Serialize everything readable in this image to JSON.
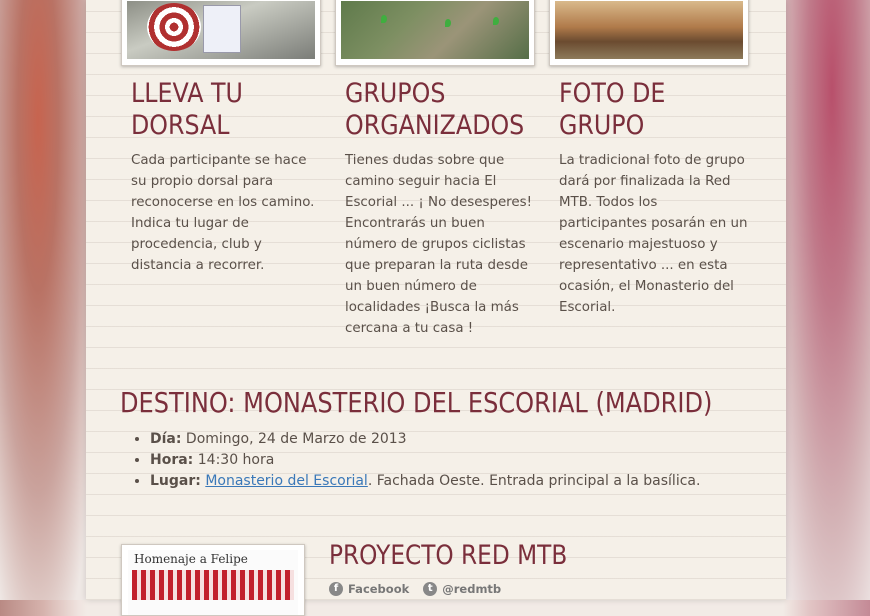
{
  "features": [
    {
      "title_line1": "LLEVA TU",
      "title_line2": "DORSAL",
      "text": "Cada participante se hace su propio dorsal para reconocerse en los camino. Indica tu lugar de procedencia, club y distancia a recorrer."
    },
    {
      "title_line1": "GRUPOS",
      "title_line2": "ORGANIZADOS",
      "text": "Tienes dudas sobre que camino seguir hacia El Escorial ... ¡ No desesperes! Encontrarás un buen número de grupos ciclistas que preparan la ruta desde un buen número de localidades ¡Busca la más cercana a tu casa !"
    },
    {
      "title_line1": "FOTO DE",
      "title_line2": "GRUPO",
      "text": "La tradicional foto de grupo dará por finalizada la Red MTB. Todos los participantes posarán en un escenario majestuoso y representativo ... en esta ocasión, el Monasterio del Escorial."
    }
  ],
  "destination": {
    "title": "DESTINO: MONASTERIO DEL ESCORIAL (MADRID)",
    "day_label": "Día:",
    "day_value": "Domingo, 24 de Marzo de 2013",
    "time_label": "Hora:",
    "time_value": "14:30 hora",
    "place_label": "Lugar:",
    "place_link": "Monasterio del Escorial",
    "place_rest": ". Fachada Oeste. Entrada principal a la basílica."
  },
  "project": {
    "title": "PROYECTO RED MTB",
    "thumb_caption": "Homenaje a Felipe",
    "facebook_label": "Facebook",
    "twitter_label": "@redmtb"
  }
}
